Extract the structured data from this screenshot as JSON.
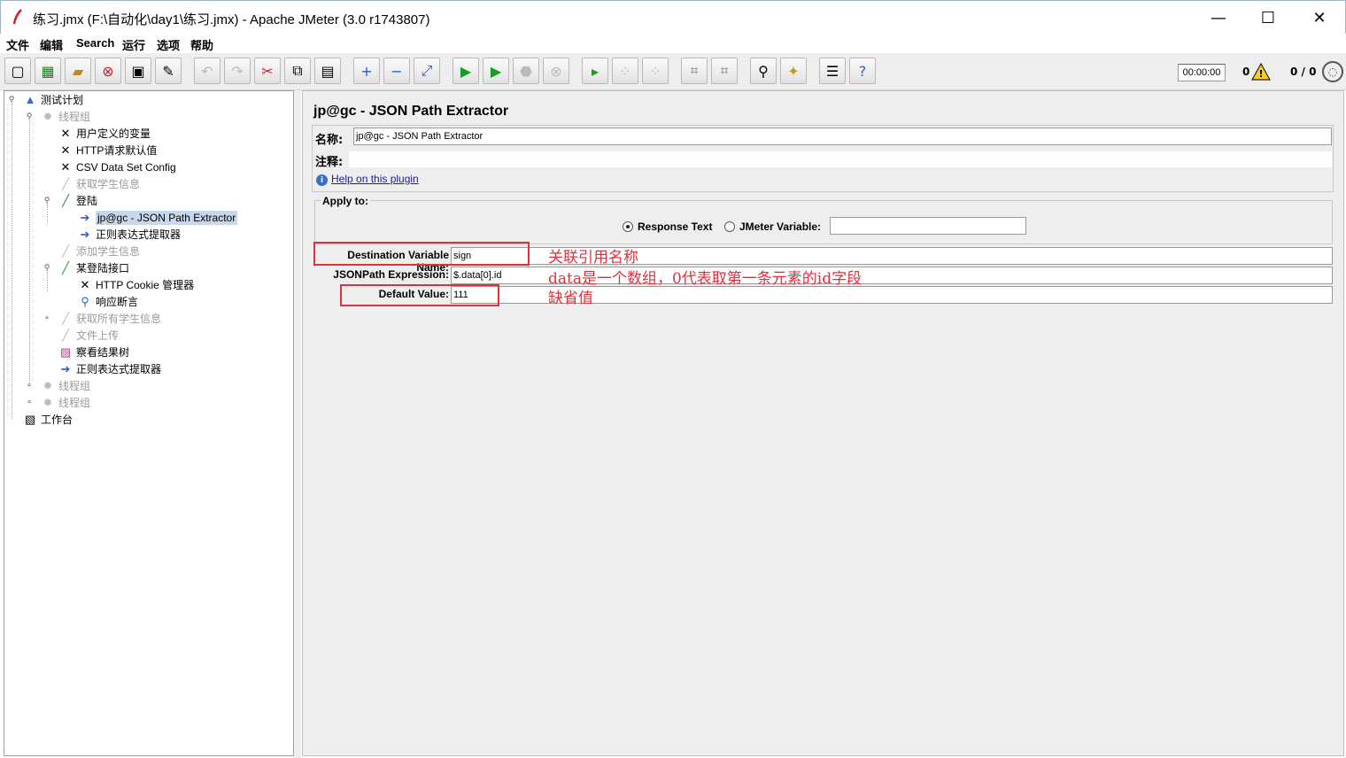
{
  "window": {
    "title": "练习.jmx (F:\\自动化\\day1\\练习.jmx) - Apache JMeter (3.0 r1743807)",
    "min": "—",
    "max": "☐",
    "close": "✕"
  },
  "menu": [
    "文件",
    "编辑",
    "Search",
    "运行",
    "选项",
    "帮助"
  ],
  "toolbar": {
    "timer": "00:00:00",
    "warnings": "0",
    "threads": "0 / 0"
  },
  "tree": [
    {
      "label": "测试计划",
      "icon": "test-plan-icon",
      "disabled": false
    },
    {
      "label": "线程组",
      "icon": "gear-icon",
      "disabled": true
    },
    {
      "label": "用户定义的变量",
      "icon": "tools-icon",
      "disabled": false
    },
    {
      "label": "HTTP请求默认值",
      "icon": "tools-icon",
      "disabled": false
    },
    {
      "label": "CSV Data Set Config",
      "icon": "tools-icon",
      "disabled": false
    },
    {
      "label": "获取学生信息",
      "icon": "pen-icon",
      "disabled": true
    },
    {
      "label": "登陆",
      "icon": "pen-icon",
      "disabled": false
    },
    {
      "label": "jp@gc - JSON Path Extractor",
      "icon": "extractor-icon",
      "disabled": false,
      "selected": true
    },
    {
      "label": "正则表达式提取器",
      "icon": "extractor-icon",
      "disabled": false
    },
    {
      "label": "添加学生信息",
      "icon": "pen-icon",
      "disabled": true
    },
    {
      "label": "某登陆接口",
      "icon": "pen-icon",
      "disabled": false
    },
    {
      "label": "HTTP Cookie 管理器",
      "icon": "tools-icon",
      "disabled": false
    },
    {
      "label": "响应断言",
      "icon": "magnifier-icon",
      "disabled": false
    },
    {
      "label": "获取所有学生信息",
      "icon": "pen-icon",
      "disabled": true
    },
    {
      "label": "文件上传",
      "icon": "pen-icon",
      "disabled": true
    },
    {
      "label": "察看结果树",
      "icon": "chart-icon",
      "disabled": false
    },
    {
      "label": "正则表达式提取器",
      "icon": "extractor-icon",
      "disabled": false
    },
    {
      "label": "线程组",
      "icon": "gear-icon",
      "disabled": true
    },
    {
      "label": "线程组",
      "icon": "gear-icon",
      "disabled": true
    },
    {
      "label": "工作台",
      "icon": "workbench-icon",
      "disabled": false
    }
  ],
  "panel": {
    "title": "jp@gc - JSON Path Extractor",
    "name_label": "名称:",
    "name_value": "jp@gc - JSON Path Extractor",
    "comment_label": "注释:",
    "help_link": "Help on this plugin",
    "apply_to_label": "Apply to:",
    "radio_response": "Response Text",
    "radio_variable": "JMeter Variable:",
    "dest_label": "Destination Variable Name:",
    "dest_value": "sign",
    "jsonpath_label": "JSONPath Expression:",
    "jsonpath_value": "$.data[0].id",
    "default_label": "Default Value:",
    "default_value": "111"
  },
  "annotations": {
    "dest": "关联引用名称",
    "jsonpath": "data是一个数组，0代表取第一条元素的id字段",
    "default": "缺省值"
  }
}
